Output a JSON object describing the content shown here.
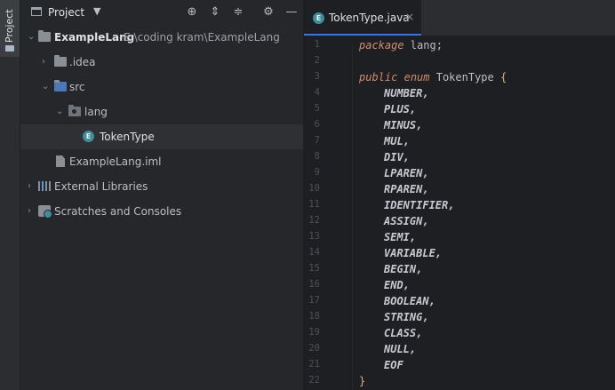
{
  "side_strip": {
    "project_tab_label": "Project"
  },
  "panel": {
    "title": "Project",
    "icons": [
      "locate-icon",
      "expand-all-icon",
      "collapse-all-icon",
      "gear-icon",
      "minimize-icon"
    ]
  },
  "tree": {
    "root": {
      "name": "ExampleLang",
      "path": "E:\\coding kram\\ExampleLang"
    },
    "idea": ".idea",
    "src": "src",
    "lang": "lang",
    "tokentype": "TokenType",
    "iml": "ExampleLang.iml",
    "external": "External Libraries",
    "scratches": "Scratches and Consoles"
  },
  "editor": {
    "tab_title": "TokenType.java",
    "tab_close": "×",
    "tab_icon_letter": "E",
    "line_numbers": [
      "1",
      "2",
      "3",
      "4",
      "5",
      "6",
      "7",
      "8",
      "9",
      "10",
      "11",
      "12",
      "13",
      "14",
      "15",
      "16",
      "17",
      "18",
      "19",
      "20",
      "21",
      "22"
    ],
    "code": {
      "package_kw": "package",
      "package_name": " lang;",
      "public_kw": "public",
      "enum_kw": "enum",
      "class_name": " TokenType ",
      "open_brace": "{",
      "close_brace": "}",
      "constants": [
        "NUMBER,",
        "PLUS,",
        "MINUS,",
        "MUL,",
        "DIV,",
        "LPAREN,",
        "RPAREN,",
        "IDENTIFIER,",
        "ASSIGN,",
        "SEMI,",
        "VARIABLE,",
        "BEGIN,",
        "END,",
        "BOOLEAN,",
        "STRING,",
        "CLASS,",
        "NULL,",
        "EOF"
      ]
    }
  }
}
